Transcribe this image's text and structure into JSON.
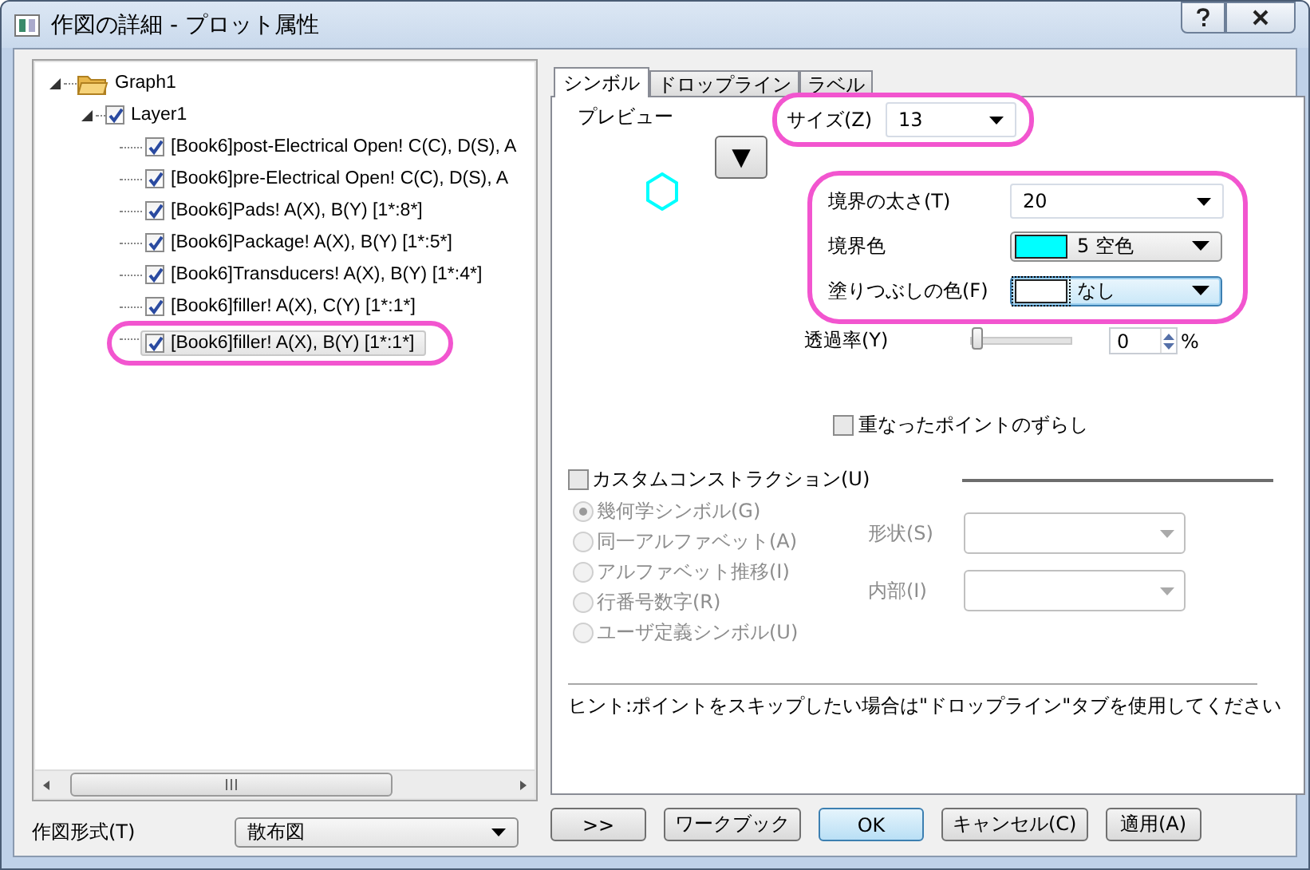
{
  "window": {
    "title": "作図の詳細 - プロット属性"
  },
  "tree": {
    "label": "Graph1",
    "expanded": true,
    "children": [
      {
        "label": "Layer1",
        "expanded": true,
        "checked": true,
        "children": [
          {
            "label": "[Book6]post-Electrical Open! C(C), D(S), A",
            "checked": true,
            "selected": false,
            "highlighted": false
          },
          {
            "label": "[Book6]pre-Electrical Open! C(C), D(S), A",
            "checked": true,
            "selected": false,
            "highlighted": false
          },
          {
            "label": "[Book6]Pads! A(X), B(Y) [1*:8*]",
            "checked": true,
            "selected": false,
            "highlighted": false
          },
          {
            "label": "[Book6]Package! A(X), B(Y) [1*:5*]",
            "checked": true,
            "selected": false,
            "highlighted": false
          },
          {
            "label": "[Book6]Transducers! A(X), B(Y) [1*:4*]",
            "checked": true,
            "selected": false,
            "highlighted": false
          },
          {
            "label": "[Book6]filler! A(X), C(Y) [1*:1*]",
            "checked": true,
            "selected": false,
            "highlighted": false
          },
          {
            "label": "[Book6]filler! A(X), B(Y) [1*:1*]",
            "checked": true,
            "selected": true,
            "highlighted": true
          }
        ]
      }
    ]
  },
  "plot_type": {
    "label": "作図形式(T)",
    "value": "散布図"
  },
  "tabs": [
    {
      "label": "シンボル",
      "selected": true
    },
    {
      "label": "ドロップライン",
      "selected": false
    },
    {
      "label": "ラベル",
      "selected": false
    }
  ],
  "symbol": {
    "preview_label": "プレビュー",
    "symbol_button": "▼",
    "size": {
      "label": "サイズ(Z)",
      "value": "13",
      "highlighted": true
    },
    "border_group": {
      "highlighted": true,
      "rows": [
        {
          "kind": "dropdown",
          "label": "境界の太さ(T)",
          "value": "20"
        },
        {
          "kind": "color",
          "label": "境界色",
          "value": "5 空色",
          "color": "#00ffff",
          "focused": false
        },
        {
          "kind": "color",
          "label": "塗りつぶしの色(F)",
          "value": "なし",
          "color": "#ffffff",
          "focused": true
        }
      ]
    },
    "transparency": {
      "label": "透過率(Y)",
      "level": 0,
      "value": "0",
      "unit": "%"
    },
    "offset_points": {
      "label": "重なったポイントのずらし",
      "checked": false
    },
    "custom": {
      "label": "カスタムコンストラクション(U)",
      "checked": false,
      "options": [
        {
          "label": "幾何学シンボル(G)",
          "selected": true,
          "disabled": true
        },
        {
          "label": "同一アルファベット(A)",
          "selected": false,
          "disabled": true
        },
        {
          "label": "アルファベット推移(I)",
          "selected": false,
          "disabled": true
        },
        {
          "label": "行番号数字(R)",
          "selected": false,
          "disabled": true
        },
        {
          "label": "ユーザ定義シンボル(U)",
          "selected": false,
          "disabled": true
        }
      ],
      "fields": [
        {
          "label": "形状(S)",
          "disabled": true
        },
        {
          "label": "内部(I)",
          "disabled": true
        }
      ]
    },
    "hint": "ヒント:ポイントをスキップしたい場合は\"ドロップライン\"タブを使用してください"
  },
  "buttons": [
    {
      "label": ">>",
      "default": false
    },
    {
      "label": "ワークブック",
      "default": false
    },
    {
      "label": "OK",
      "default": true
    },
    {
      "label": "キャンセル(C)",
      "default": false
    },
    {
      "label": "適用(A)",
      "default": false
    }
  ]
}
